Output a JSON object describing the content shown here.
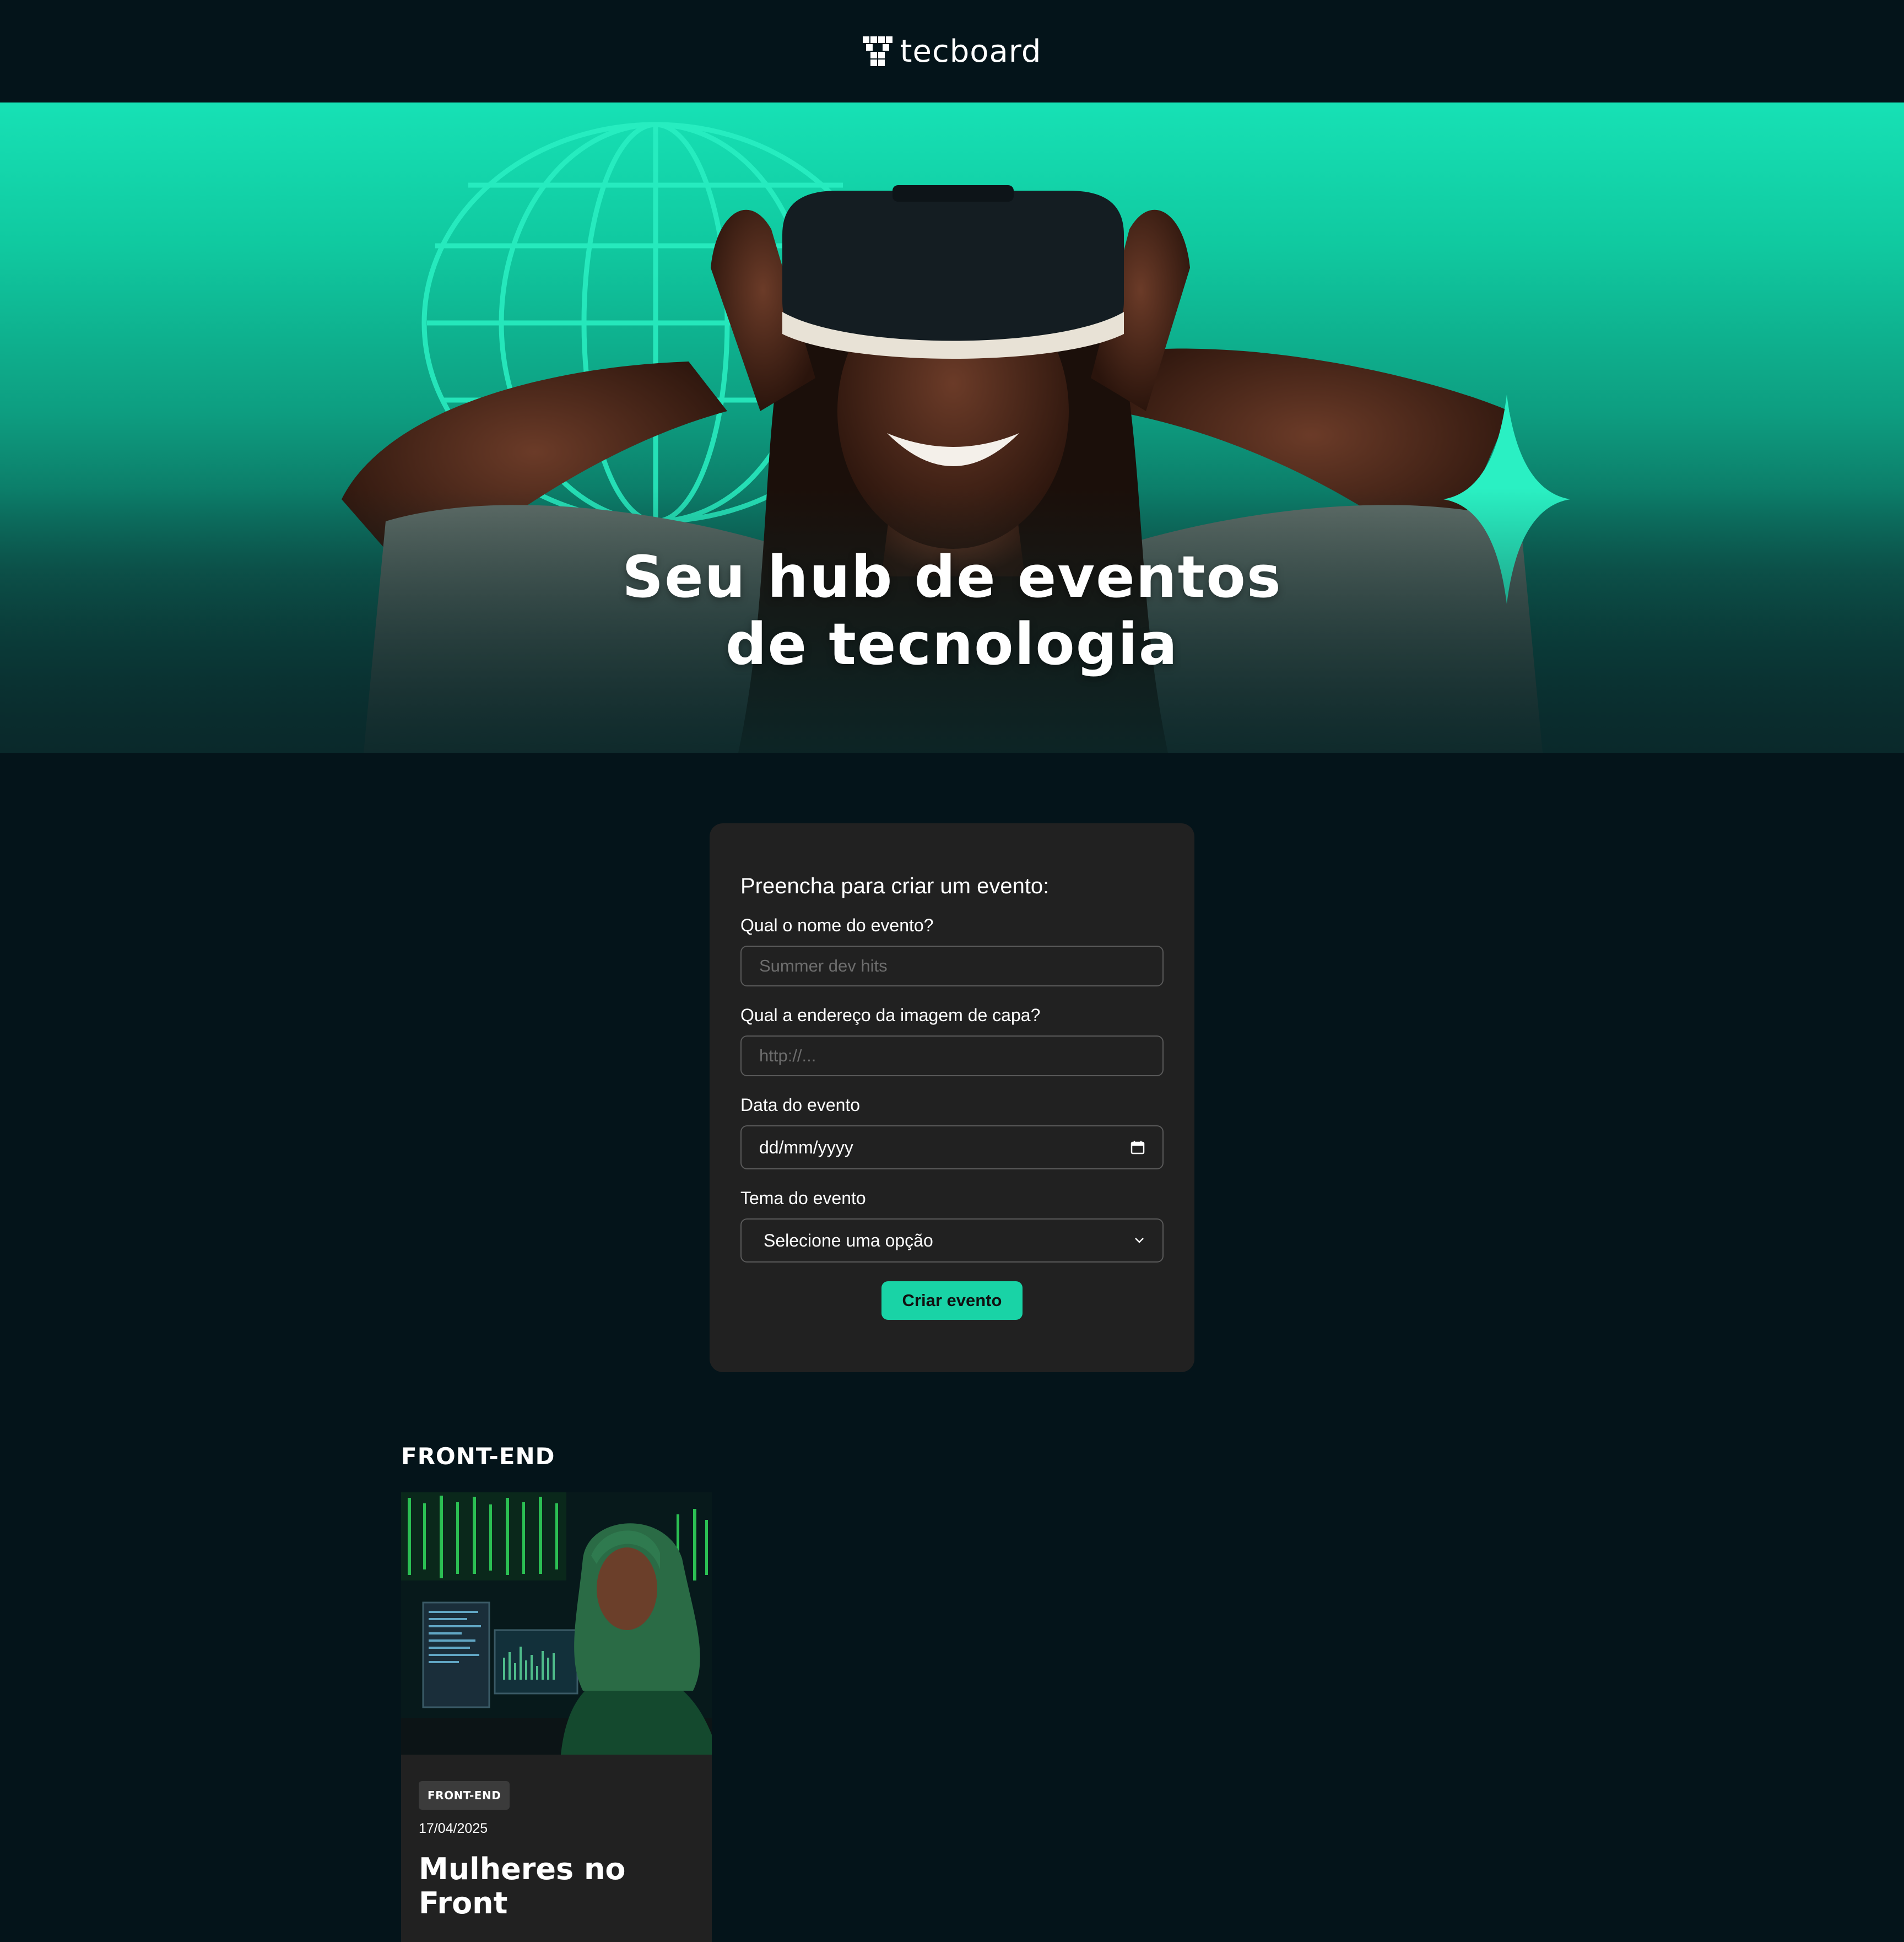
{
  "header": {
    "brand_name": "tecboard",
    "logo_icon": "tecboard-logo-icon"
  },
  "hero": {
    "title_line1": "Seu hub de eventos",
    "title_line2": "de tecnologia",
    "image": "woman-with-vr-headset"
  },
  "form": {
    "heading": "Preencha para criar um evento:",
    "event_name": {
      "label": "Qual o nome do evento?",
      "placeholder": "Summer dev hits",
      "value": ""
    },
    "cover_image": {
      "label": "Qual a endereço da imagem de capa?",
      "placeholder": "http://...",
      "value": ""
    },
    "event_date": {
      "label": "Data do evento",
      "placeholder": "dd/mm/yyyy",
      "icon": "calendar-icon"
    },
    "event_theme": {
      "label": "Tema do evento",
      "selected": "Selecione uma opção",
      "icon": "chevron-down-icon"
    },
    "submit_label": "Criar evento"
  },
  "sections": [
    {
      "title": "FRONT-END",
      "events": [
        {
          "tag": "FRONT-END",
          "date": "17/04/2025",
          "name": "Mulheres no Front",
          "image": "woman-at-computer-monitors"
        }
      ]
    }
  ],
  "colors": {
    "background": "#04141a",
    "accent": "#19d3a6",
    "card": "#212121",
    "hero_top": "#17e1b5"
  }
}
